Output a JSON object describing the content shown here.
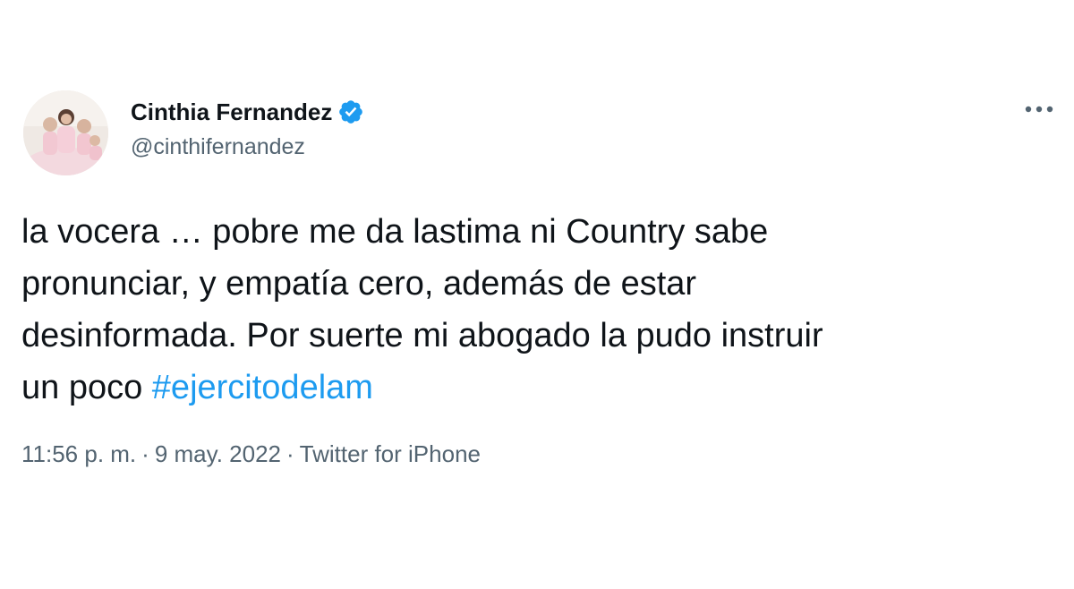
{
  "author": {
    "display_name": "Cinthia Fernandez",
    "handle": "@cinthifernandez",
    "verified": true,
    "avatar_icon": "profile-photo-icon"
  },
  "tweet": {
    "lines": [
      "la vocera … pobre me da lastima ni Country sabe",
      "pronunciar, y empatía cero, además de estar",
      "desinformada. Por suerte mi abogado la pudo instruir",
      "un poco "
    ],
    "hashtag": "#ejercitodelam"
  },
  "meta": {
    "time": "11:56 p. m.",
    "separator": "·",
    "date": "9 may. 2022",
    "source": "Twitter for iPhone"
  },
  "icons": {
    "more": "more-options-icon",
    "verified": "verified-badge-icon"
  },
  "colors": {
    "accent": "#1d9bf0",
    "secondary_text": "#536471",
    "primary_text": "#0f1419"
  }
}
